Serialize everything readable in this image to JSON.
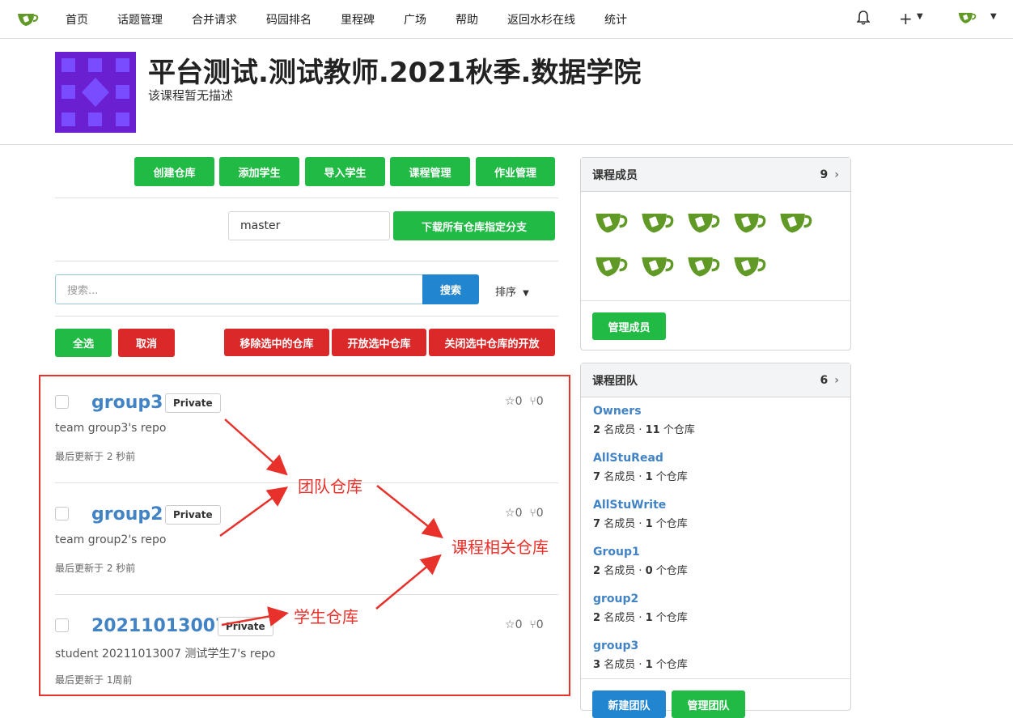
{
  "nav": {
    "items": [
      "首页",
      "话题管理",
      "合并请求",
      "码园排名",
      "里程碑",
      "广场",
      "帮助",
      "返回水杉在线",
      "统计"
    ],
    "plus": "+"
  },
  "header": {
    "title": "平台测试.测试教师.2021秋季.数据学院",
    "description": "该课程暂无描述"
  },
  "actions": [
    "创建仓库",
    "添加学生",
    "导入学生",
    "课程管理",
    "作业管理"
  ],
  "branch": {
    "value": "master",
    "button": "下载所有仓库指定分支"
  },
  "search": {
    "placeholder": "搜索...",
    "button": "搜索",
    "sort": "排序"
  },
  "select": {
    "all": "全选",
    "cancel": "取消",
    "remove": "移除选中的仓库",
    "open": "开放选中仓库",
    "close": "关闭选中仓库的开放"
  },
  "repos": [
    {
      "name": "group3",
      "badge": "Private",
      "desc": "team group3's repo",
      "updated": "最后更新于 2 秒前",
      "stars": "0",
      "forks": "0"
    },
    {
      "name": "group2",
      "badge": "Private",
      "desc": "team group2's repo",
      "updated": "最后更新于 2 秒前",
      "stars": "0",
      "forks": "0"
    },
    {
      "name": "20211013007",
      "badge": "Private",
      "desc": "student 20211013007 测试学生7's repo",
      "updated": "最后更新于 1周前",
      "stars": "0",
      "forks": "0"
    }
  ],
  "members": {
    "title": "课程成员",
    "count": "9",
    "manage": "管理成员"
  },
  "teams": {
    "title": "课程团队",
    "count": "6",
    "items": [
      {
        "name": "Owners",
        "members": "2",
        "repos": "11",
        "members_label": "名成员 ·",
        "repos_label": "个仓库"
      },
      {
        "name": "AllStuRead",
        "members": "7",
        "repos": "1",
        "members_label": "名成员 ·",
        "repos_label": "个仓库"
      },
      {
        "name": "AllStuWrite",
        "members": "7",
        "repos": "1",
        "members_label": "名成员 ·",
        "repos_label": "个仓库"
      },
      {
        "name": "Group1",
        "members": "2",
        "repos": "0",
        "members_label": "名成员 ·",
        "repos_label": "个仓库"
      },
      {
        "name": "group2",
        "members": "2",
        "repos": "1",
        "members_label": "名成员 ·",
        "repos_label": "个仓库"
      },
      {
        "name": "group3",
        "members": "3",
        "repos": "1",
        "members_label": "名成员 ·",
        "repos_label": "个仓库"
      }
    ],
    "new_team": "新建团队",
    "manage_team": "管理团队"
  },
  "annotations": {
    "team_repo": "团队仓库",
    "course_repo": "课程相关仓库",
    "student_repo": "学生仓库"
  },
  "colors": {
    "green": "#21ba45",
    "red": "#db2828",
    "blue": "#2185d0",
    "link": "#4183c4",
    "annotation": "#e8312a"
  }
}
